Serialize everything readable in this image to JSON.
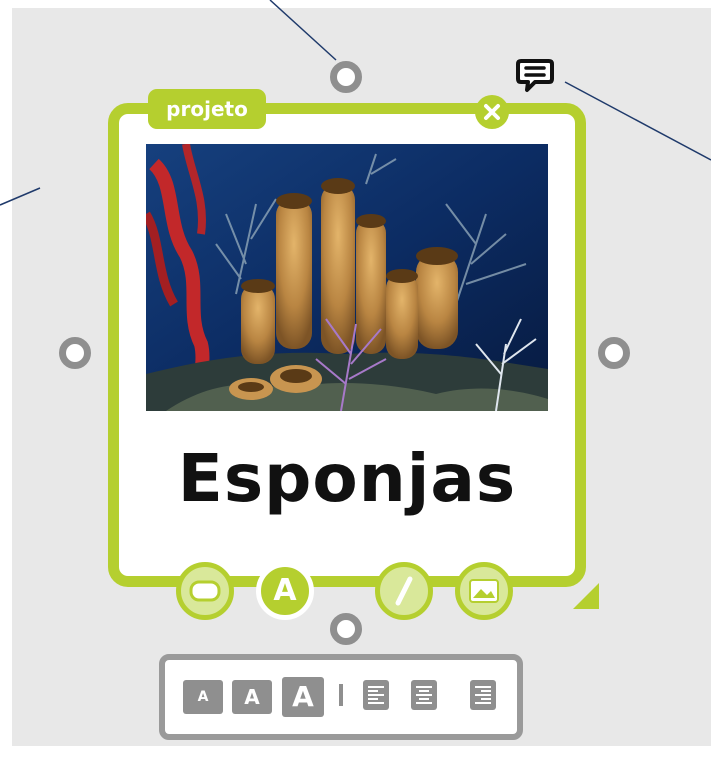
{
  "card": {
    "tag_label": "projeto",
    "title": "Esponjas",
    "image_description": "coral-reef-sponges-photo"
  },
  "icons": {
    "close": "close-icon",
    "comment": "comment-icon",
    "shape": "shape-tool-icon",
    "text": "text-tool-icon",
    "pencil": "pencil-tool-icon",
    "image": "image-tool-icon"
  },
  "tools": {
    "text_label": "A"
  },
  "text_toolbar": {
    "size_small": "A",
    "size_medium": "A",
    "size_large": "A"
  },
  "colors": {
    "accent": "#b5cf2f",
    "handle": "#8f8f8f",
    "canvas": "#e8e8e8",
    "connector": "#1f3a6b"
  }
}
